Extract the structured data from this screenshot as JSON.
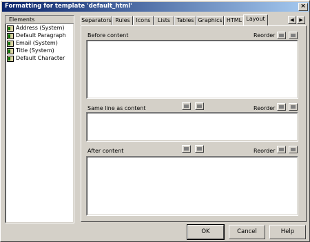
{
  "window": {
    "title": "Formatting for template 'default_html'",
    "close_label": "×"
  },
  "elements": {
    "header": "Elements",
    "items": [
      {
        "label": "Address (System)"
      },
      {
        "label": "Default Paragraph"
      },
      {
        "label": "Email (System)"
      },
      {
        "label": "Title (System)"
      },
      {
        "label": "Default Character"
      }
    ]
  },
  "tabs": [
    {
      "label": "Separators"
    },
    {
      "label": "Rules"
    },
    {
      "label": "Icons"
    },
    {
      "label": "Lists"
    },
    {
      "label": "Tables"
    },
    {
      "label": "Graphics"
    },
    {
      "label": "HTML"
    },
    {
      "label": "Layout",
      "active": true
    }
  ],
  "tab_scroll": {
    "left": "◀",
    "right": "▶"
  },
  "layout": {
    "before_label": "Before content",
    "same_line_label": "Same line as content",
    "after_label": "After content",
    "reorder_label": "Reorder"
  },
  "buttons": {
    "ok": "OK",
    "cancel": "Cancel",
    "help": "Help"
  }
}
